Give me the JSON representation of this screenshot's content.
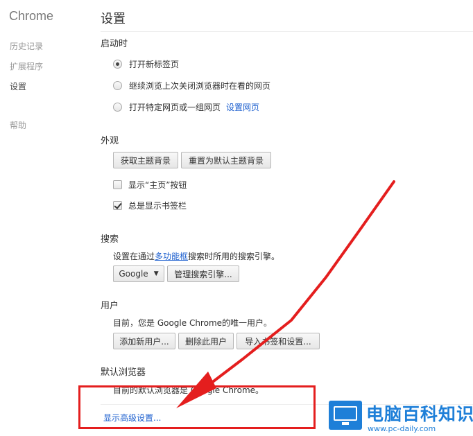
{
  "sidebar": {
    "brand": "Chrome",
    "items": [
      {
        "label": "历史记录"
      },
      {
        "label": "扩展程序"
      },
      {
        "label": "设置"
      },
      {
        "label": "帮助"
      }
    ]
  },
  "page": {
    "title": "设置"
  },
  "startup": {
    "title": "启动时",
    "options": [
      {
        "label": "打开新标签页",
        "checked": true
      },
      {
        "label": "继续浏览上次关闭浏览器时在看的网页",
        "checked": false
      },
      {
        "label": "打开特定网页或一组网页",
        "checked": false
      }
    ],
    "set_pages_link": "设置网页"
  },
  "appearance": {
    "title": "外观",
    "get_themes_button": "获取主题背景",
    "reset_theme_button": "重置为默认主题背景",
    "show_home_button": {
      "label": "显示“主页”按钮",
      "checked": false
    },
    "show_bookmarks_bar": {
      "label": "总是显示书签栏",
      "checked": true
    }
  },
  "search": {
    "title": "搜索",
    "desc_prefix": "设置在通过",
    "omnibox_link": "多功能框",
    "desc_suffix": "搜索时所用的搜索引擎。",
    "engine_selected": "Google",
    "manage_button": "管理搜索引擎..."
  },
  "users": {
    "title": "用户",
    "desc": "目前，您是 Google Chrome的唯一用户。",
    "add_button": "添加新用户...",
    "delete_button": "删除此用户",
    "import_button": "导入书签和设置..."
  },
  "default_browser": {
    "title": "默认浏览器",
    "desc": "目前的默认浏览器是 Google Chrome。"
  },
  "advanced_link": "显示高级设置...",
  "annotation": {
    "color": "#e41e1e"
  },
  "watermark": {
    "title": "电脑百科知识",
    "url": "www.pc-daily.com",
    "color": "#1e7fd8"
  },
  "icons": {
    "caret": "caret-down-icon",
    "logo": "monitor-logo-icon"
  }
}
